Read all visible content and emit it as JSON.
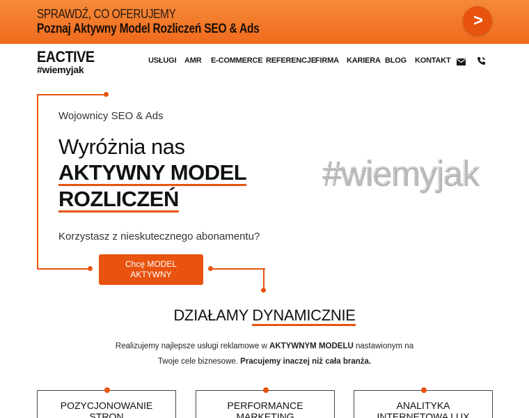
{
  "promo": {
    "pre_title": "SPRAWDŹ, CO OFERUJEMY",
    "title": "Poznaj Aktywny Model Rozliczeń SEO & Ads",
    "arrow": ">",
    "accent": "#e8530f"
  },
  "logo": {
    "line1": "EACTIVE",
    "line2": "#wiemyjak"
  },
  "nav": {
    "items": [
      {
        "label": "USŁUGI"
      },
      {
        "label": "AMR"
      },
      {
        "label": "E-COMMERCE"
      },
      {
        "label": "REFERENCJE"
      },
      {
        "label": "FIRMA"
      },
      {
        "label": "KARIERA"
      },
      {
        "label": "BLOG"
      },
      {
        "label": "KONTAKT"
      }
    ],
    "icons": [
      "envelope-icon",
      "phone-icon"
    ]
  },
  "hero": {
    "kicker": "Wojownicy SEO & Ads",
    "headline_line1": "Wyróżnia nas",
    "headline_line2": "AKTYWNY MODEL",
    "headline_line3": "ROZLICZEŃ",
    "subtitle": "Korzystasz z nieskutecznego abonamentu?",
    "cta_line1": "Chcę MODEL",
    "cta_line2": "AKTYWNY",
    "hashtag": "#wiemyjak"
  },
  "section2": {
    "title_plain": "DZIAŁAMY ",
    "title_highlight": "DYNAMICZNIE",
    "body_part1": "Realizujemy najlepsze usługi reklamowe w ",
    "body_bold1": "AKTYWNYM MODELU",
    "body_part2": " nastawionym na Twoje cele biznesowe. ",
    "body_bold2": "Pracujemy inaczej niż cała branża."
  },
  "cards": [
    {
      "line1": "POZYCJONOWANIE",
      "line2": "STRON"
    },
    {
      "line1": "PERFORMANCE",
      "line2": "MARKETING"
    },
    {
      "line1": "ANALITYKA",
      "line2": "INTERNETOWA LUX"
    }
  ]
}
